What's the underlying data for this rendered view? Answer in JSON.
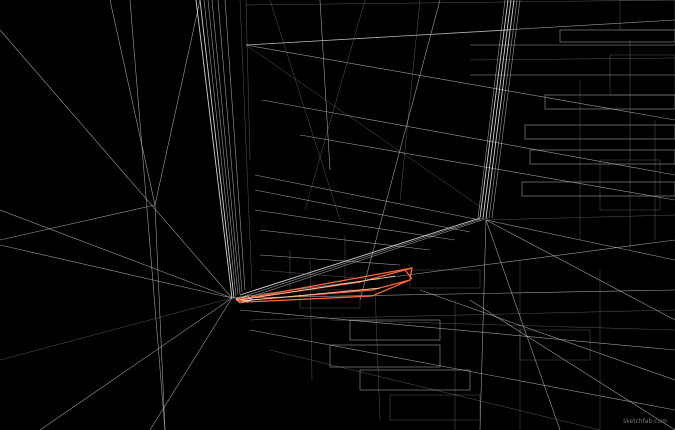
{
  "viewport": {
    "background": "#000000",
    "wire_color": "#cfcfcf",
    "selection_color": "#ff6a3a",
    "selected_object": "selected-wedge-mesh"
  },
  "watermark": {
    "text": "sketchfab.com"
  }
}
